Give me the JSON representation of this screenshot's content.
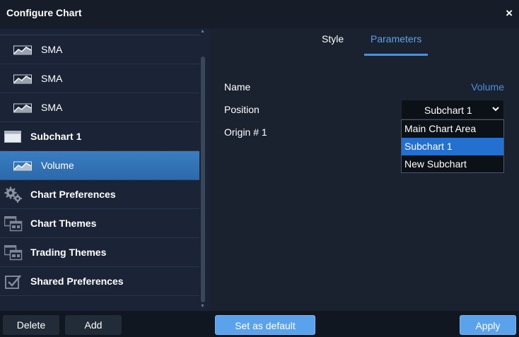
{
  "window": {
    "title": "Configure Chart",
    "close_glyph": "×"
  },
  "sidebar": {
    "items": [
      {
        "label": "SMA",
        "icon": "line-chart-icon",
        "bold": false,
        "selected": false
      },
      {
        "label": "SMA",
        "icon": "line-chart-icon",
        "bold": false,
        "selected": false
      },
      {
        "label": "SMA",
        "icon": "line-chart-icon",
        "bold": false,
        "selected": false
      },
      {
        "label": "Subchart 1",
        "icon": "window-icon",
        "bold": true,
        "selected": false
      },
      {
        "label": "Volume",
        "icon": "line-chart-icon",
        "bold": false,
        "selected": true
      },
      {
        "label": "Chart Preferences",
        "icon": "gears-icon",
        "bold": true,
        "selected": false
      },
      {
        "label": "Chart Themes",
        "icon": "themes-icon",
        "bold": true,
        "selected": false
      },
      {
        "label": "Trading Themes",
        "icon": "themes-icon",
        "bold": true,
        "selected": false
      },
      {
        "label": "Shared Preferences",
        "icon": "checkbox-icon",
        "bold": true,
        "selected": false
      }
    ]
  },
  "tabs": [
    {
      "label": "Style",
      "active": false
    },
    {
      "label": "Parameters",
      "active": true
    }
  ],
  "params": {
    "name_label": "Name",
    "name_value": "Volume",
    "position_label": "Position",
    "position_value": "Subchart 1",
    "origin_label": "Origin # 1",
    "position_options": [
      "Main Chart Area",
      "Subchart 1",
      "New Subchart"
    ],
    "position_selected_index": 1
  },
  "footer": {
    "delete_label": "Delete",
    "add_label": "Add",
    "set_default_label": "Set as default",
    "apply_label": "Apply"
  },
  "colors": {
    "accent": "#4a90e2",
    "selected_row": "#3a7dc2",
    "button_blue": "#5aa3ec",
    "background": "#1a2230"
  }
}
